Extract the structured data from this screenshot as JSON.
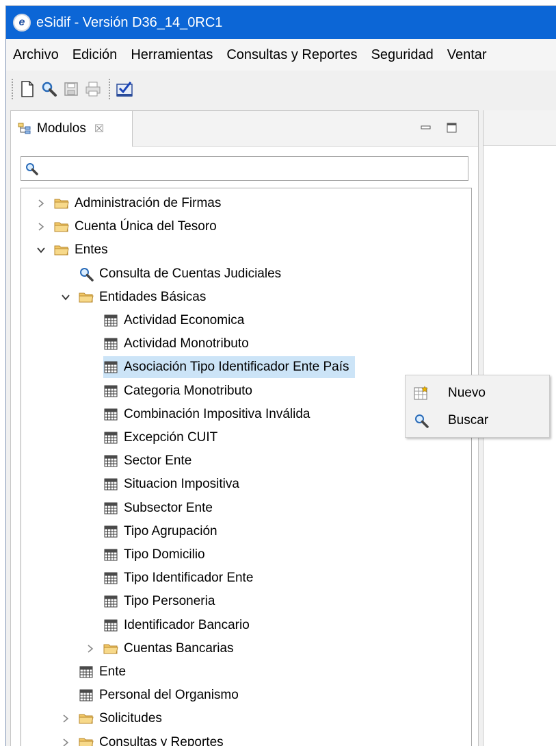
{
  "window": {
    "title": "eSidif - Versión D36_14_0RC1"
  },
  "menubar": {
    "items": [
      {
        "label": "Archivo"
      },
      {
        "label": "Edición"
      },
      {
        "label": "Herramientas"
      },
      {
        "label": "Consultas y Reportes"
      },
      {
        "label": "Seguridad"
      },
      {
        "label": "Ventar"
      }
    ]
  },
  "toolbar": {
    "icons": [
      "new-document-icon",
      "search-icon",
      "save-icon",
      "print-icon",
      "checklist-icon"
    ]
  },
  "panel": {
    "tab_label": "Modulos",
    "tab_close": "☒"
  },
  "search": {
    "value": "",
    "placeholder": ""
  },
  "tree": [
    {
      "label": "Administración de Firmas",
      "type": "folder",
      "expanded": false
    },
    {
      "label": "Cuenta Única del Tesoro",
      "type": "folder",
      "expanded": false
    },
    {
      "label": "Entes",
      "type": "folder",
      "expanded": true
    },
    {
      "label": "Consulta de Cuentas Judiciales",
      "type": "query"
    },
    {
      "label": "Entidades Básicas",
      "type": "folder",
      "expanded": true
    },
    {
      "label": "Actividad Economica",
      "type": "table"
    },
    {
      "label": "Actividad Monotributo",
      "type": "table"
    },
    {
      "label": "Asociación Tipo Identificador Ente País",
      "type": "table",
      "selected": true
    },
    {
      "label": "Categoria Monotributo",
      "type": "table"
    },
    {
      "label": "Combinación Impositiva Inválida",
      "type": "table"
    },
    {
      "label": "Excepción CUIT",
      "type": "table"
    },
    {
      "label": "Sector Ente",
      "type": "table"
    },
    {
      "label": "Situacion Impositiva",
      "type": "table"
    },
    {
      "label": "Subsector Ente",
      "type": "table"
    },
    {
      "label": "Tipo Agrupación",
      "type": "table"
    },
    {
      "label": "Tipo Domicilio",
      "type": "table"
    },
    {
      "label": "Tipo Identificador Ente",
      "type": "table"
    },
    {
      "label": "Tipo Personeria",
      "type": "table"
    },
    {
      "label": "Identificador Bancario",
      "type": "table"
    },
    {
      "label": "Cuentas Bancarias",
      "type": "folder",
      "expanded": false
    },
    {
      "label": "Ente",
      "type": "table"
    },
    {
      "label": "Personal del Organismo",
      "type": "table"
    },
    {
      "label": "Solicitudes",
      "type": "folder",
      "expanded": false
    },
    {
      "label": "Consultas y Reportes",
      "type": "folder",
      "expanded": false
    }
  ],
  "context_menu": {
    "items": [
      {
        "label": "Nuevo",
        "icon": "new-record-icon"
      },
      {
        "label": "Buscar",
        "icon": "search-icon"
      }
    ]
  },
  "colors": {
    "titlebar": "#0c66d6",
    "selection": "#cce4f7",
    "folder": "#f2c867"
  }
}
